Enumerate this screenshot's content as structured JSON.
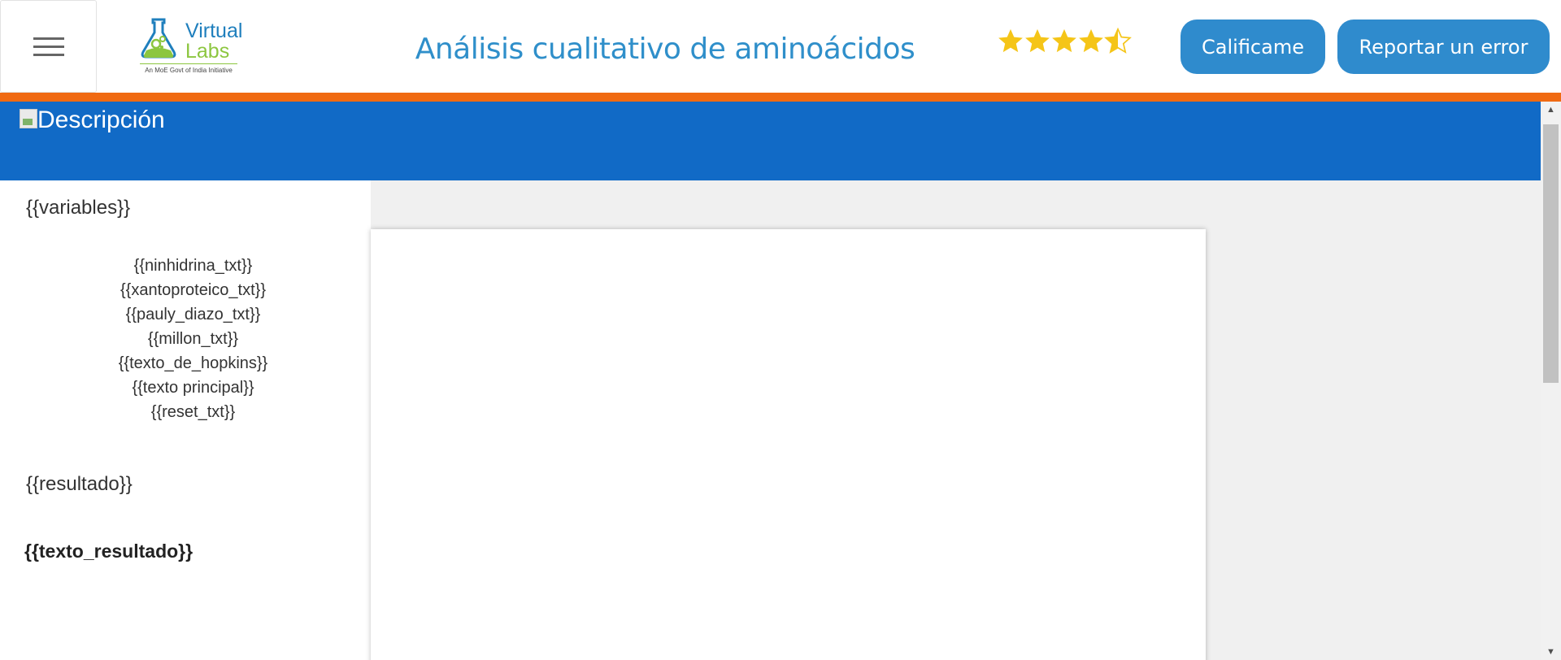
{
  "header": {
    "menu_icon": "hamburger-icon",
    "logo": {
      "line1": "Virtual",
      "line2": "Labs",
      "tagline": "An MoE Govt of India Initiative"
    },
    "title": "Análisis cualitativo de aminoácidos",
    "rating": {
      "value": 4.5,
      "max": 5,
      "color": "#f5c518"
    },
    "rate_button": "Calificame",
    "report_button": "Reportar un error"
  },
  "colors": {
    "accent": "#2f8bcd",
    "banner": "#116ac6",
    "orange_bar": "#f06a12"
  },
  "banner": {
    "image_alt": "Descripción"
  },
  "left_panel": {
    "variables_heading": "{{variables}}",
    "items": [
      "{{ninhidrina_txt}}",
      "{{xantoproteico_txt}}",
      "{{pauly_diazo_txt}}",
      "{{millon_txt}}",
      "{{texto_de_hopkins}}",
      "{{texto principal}}",
      "{{reset_txt}}"
    ],
    "resultado_heading": "{{resultado}}",
    "resultado_text": "{{texto_resultado}}"
  }
}
